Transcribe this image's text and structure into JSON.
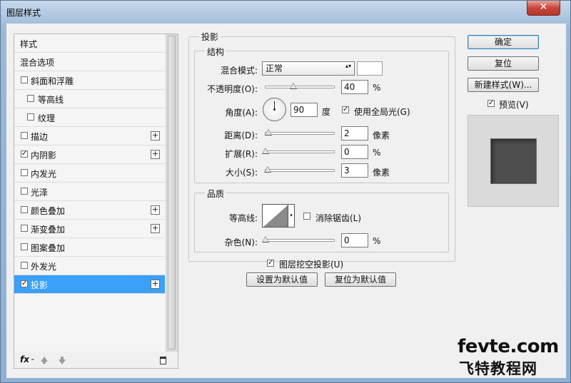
{
  "window": {
    "title": "图层样式",
    "close_label": "✕"
  },
  "sidebar": {
    "items": [
      {
        "label": "样式",
        "checked": null,
        "has_add": false
      },
      {
        "label": "混合选项",
        "checked": null,
        "has_add": false
      },
      {
        "label": "斜面和浮雕",
        "checked": false,
        "has_add": false
      },
      {
        "label": "等高线",
        "checked": false,
        "has_add": false
      },
      {
        "label": "纹理",
        "checked": false,
        "has_add": false
      },
      {
        "label": "描边",
        "checked": false,
        "has_add": true
      },
      {
        "label": "内阴影",
        "checked": true,
        "has_add": true
      },
      {
        "label": "内发光",
        "checked": false,
        "has_add": false
      },
      {
        "label": "光泽",
        "checked": false,
        "has_add": false
      },
      {
        "label": "颜色叠加",
        "checked": false,
        "has_add": true
      },
      {
        "label": "渐变叠加",
        "checked": false,
        "has_add": true
      },
      {
        "label": "图案叠加",
        "checked": false,
        "has_add": false
      },
      {
        "label": "外发光",
        "checked": false,
        "has_add": false
      },
      {
        "label": "投影",
        "checked": true,
        "has_add": true,
        "selected": true
      }
    ],
    "checkmark": "✓",
    "plus": "+",
    "footer": {
      "fx_label": "fx",
      "fx_arrow": "⌄"
    }
  },
  "drop_shadow": {
    "section_title": "投影",
    "structure": {
      "title": "结构",
      "blend_mode_label": "混合模式:",
      "blend_mode_value": "正常",
      "blend_mode_chevron": "▴▾",
      "opacity_label": "不透明度(O):",
      "opacity_value": "40",
      "opacity_unit": "%",
      "opacity_fraction": 0.4,
      "angle_label": "角度(A):",
      "angle_value": "90",
      "angle_unit": "度",
      "global_light_label": "使用全局光(G)",
      "global_light_checked": true,
      "distance_label": "距离(D):",
      "distance_value": "2",
      "distance_unit": "像素",
      "spread_label": "扩展(R):",
      "spread_value": "0",
      "spread_unit": "%",
      "size_label": "大小(S):",
      "size_value": "3",
      "size_unit": "像素"
    },
    "quality": {
      "title": "品质",
      "contour_label": "等高线:",
      "antialias_label": "消除锯齿(L)",
      "antialias_checked": false,
      "noise_label": "杂色(N):",
      "noise_value": "0",
      "noise_unit": "%"
    },
    "knockout_label": "图层挖空投影(U)",
    "knockout_checked": true,
    "make_default_label": "设置为默认值",
    "reset_default_label": "复位为默认值"
  },
  "actions": {
    "ok_label": "确定",
    "reset_label": "复位",
    "new_style_label": "新建样式(W)...",
    "preview_label": "预览(V)",
    "preview_checked": true
  },
  "watermark": {
    "line1": "fevte.com",
    "line2": "飞特教程网"
  }
}
